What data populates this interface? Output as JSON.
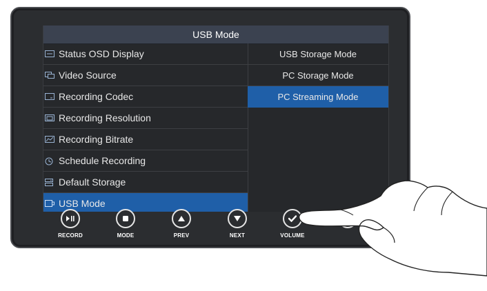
{
  "screen": {
    "title": "USB Mode",
    "menu": [
      {
        "label": "Status OSD Display",
        "icon": "osd-icon"
      },
      {
        "label": "Video Source",
        "icon": "video-source-icon"
      },
      {
        "label": "Recording Codec",
        "icon": "codec-icon"
      },
      {
        "label": "Recording Resolution",
        "icon": "resolution-icon"
      },
      {
        "label": "Recording Bitrate",
        "icon": "bitrate-icon"
      },
      {
        "label": "Schedule Recording",
        "icon": "clock-icon"
      },
      {
        "label": "Default Storage",
        "icon": "storage-icon"
      },
      {
        "label": "USB Mode",
        "icon": "usb-mode-icon",
        "active": true
      }
    ],
    "options": [
      {
        "label": "USB Storage Mode"
      },
      {
        "label": "PC Storage Mode"
      },
      {
        "label": "PC Streaming Mode",
        "selected": true
      }
    ]
  },
  "buttons": [
    {
      "label": "RECORD",
      "icon": "play-pause-icon"
    },
    {
      "label": "MODE",
      "icon": "stop-square-icon"
    },
    {
      "label": "PREV",
      "icon": "up-triangle-icon"
    },
    {
      "label": "NEXT",
      "icon": "down-triangle-icon"
    },
    {
      "label": "VOLUME",
      "icon": "checkmark-icon"
    },
    {
      "label": "",
      "icon": "gear-icon"
    }
  ],
  "colors": {
    "highlight": "#1f5fa8",
    "title_bar": "#3b4250",
    "screen_bg": "#26282b"
  }
}
